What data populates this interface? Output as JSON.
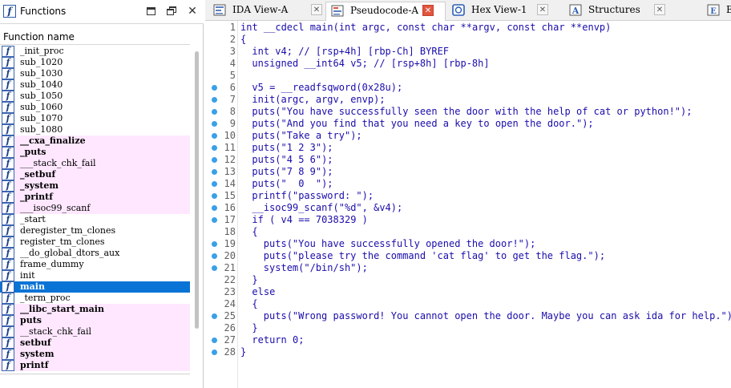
{
  "functions_panel": {
    "title": "Functions",
    "column_header": "Function name",
    "items": [
      {
        "name": "_init_proc",
        "lib": false,
        "bold": false
      },
      {
        "name": "sub_1020",
        "lib": false,
        "bold": false
      },
      {
        "name": "sub_1030",
        "lib": false,
        "bold": false
      },
      {
        "name": "sub_1040",
        "lib": false,
        "bold": false
      },
      {
        "name": "sub_1050",
        "lib": false,
        "bold": false
      },
      {
        "name": "sub_1060",
        "lib": false,
        "bold": false
      },
      {
        "name": "sub_1070",
        "lib": false,
        "bold": false
      },
      {
        "name": "sub_1080",
        "lib": false,
        "bold": false
      },
      {
        "name": "__cxa_finalize",
        "lib": true,
        "bold": true
      },
      {
        "name": "_puts",
        "lib": true,
        "bold": true
      },
      {
        "name": "___stack_chk_fail",
        "lib": true,
        "bold": false
      },
      {
        "name": "_setbuf",
        "lib": true,
        "bold": true
      },
      {
        "name": "_system",
        "lib": true,
        "bold": true
      },
      {
        "name": "_printf",
        "lib": true,
        "bold": true
      },
      {
        "name": "___isoc99_scanf",
        "lib": true,
        "bold": false
      },
      {
        "name": "_start",
        "lib": false,
        "bold": false
      },
      {
        "name": "deregister_tm_clones",
        "lib": false,
        "bold": false
      },
      {
        "name": "register_tm_clones",
        "lib": false,
        "bold": false
      },
      {
        "name": "__do_global_dtors_aux",
        "lib": false,
        "bold": false
      },
      {
        "name": "frame_dummy",
        "lib": false,
        "bold": false
      },
      {
        "name": "init",
        "lib": false,
        "bold": false
      },
      {
        "name": "main",
        "lib": false,
        "bold": true,
        "selected": true
      },
      {
        "name": "_term_proc",
        "lib": false,
        "bold": false
      },
      {
        "name": "__libc_start_main",
        "lib": true,
        "bold": true
      },
      {
        "name": "puts",
        "lib": true,
        "bold": true
      },
      {
        "name": "__stack_chk_fail",
        "lib": true,
        "bold": false
      },
      {
        "name": "setbuf",
        "lib": true,
        "bold": true
      },
      {
        "name": "system",
        "lib": true,
        "bold": true
      },
      {
        "name": "printf",
        "lib": true,
        "bold": true
      }
    ]
  },
  "tabs": [
    {
      "label": "IDA View-A",
      "icon": "ida-view-icon",
      "active": false
    },
    {
      "label": "Pseudocode-A",
      "icon": "pseudocode-icon",
      "active": true
    },
    {
      "label": "Hex View-1",
      "icon": "hex-view-icon",
      "active": false
    },
    {
      "label": "Structures",
      "icon": "structures-icon",
      "active": false
    },
    {
      "label": "En",
      "icon": "enums-icon",
      "active": false
    }
  ],
  "code": {
    "lines": [
      {
        "num": "1",
        "dot": false,
        "indent": 0,
        "text": "int __cdecl main(int argc, const char **argv, const char **envp)"
      },
      {
        "num": "2",
        "dot": false,
        "indent": 0,
        "text": "{"
      },
      {
        "num": "3",
        "dot": false,
        "indent": 2,
        "text": "int v4; // [rsp+4h] [rbp-Ch] BYREF",
        "style": "decl"
      },
      {
        "num": "4",
        "dot": false,
        "indent": 2,
        "text": "unsigned __int64 v5; // [rsp+8h] [rbp-8h]",
        "style": "decl"
      },
      {
        "num": "5",
        "dot": false,
        "indent": 0,
        "text": ""
      },
      {
        "num": "6",
        "dot": true,
        "indent": 2,
        "text": "v5 = __readfsqword(0x28u);"
      },
      {
        "num": "7",
        "dot": true,
        "indent": 2,
        "text": "init(argc, argv, envp);"
      },
      {
        "num": "8",
        "dot": true,
        "indent": 2,
        "text": "puts(\"You have successfully seen the door with the help of cat or python!\");"
      },
      {
        "num": "9",
        "dot": true,
        "indent": 2,
        "text": "puts(\"And you find that you need a key to open the door.\");"
      },
      {
        "num": "10",
        "dot": true,
        "indent": 2,
        "text": "puts(\"Take a try\");"
      },
      {
        "num": "11",
        "dot": true,
        "indent": 2,
        "text": "puts(\"1 2 3\");"
      },
      {
        "num": "12",
        "dot": true,
        "indent": 2,
        "text": "puts(\"4 5 6\");"
      },
      {
        "num": "13",
        "dot": true,
        "indent": 2,
        "text": "puts(\"7 8 9\");"
      },
      {
        "num": "14",
        "dot": true,
        "indent": 2,
        "text": "puts(\"  0  \");"
      },
      {
        "num": "15",
        "dot": true,
        "indent": 2,
        "text": "printf(\"password: \");"
      },
      {
        "num": "16",
        "dot": true,
        "indent": 2,
        "text": "__isoc99_scanf(\"%d\", &v4);"
      },
      {
        "num": "17",
        "dot": true,
        "indent": 2,
        "text": "if ( v4 == 7038329 )"
      },
      {
        "num": "18",
        "dot": false,
        "indent": 2,
        "text": "{"
      },
      {
        "num": "19",
        "dot": true,
        "indent": 4,
        "text": "puts(\"You have successfully opened the door!\");"
      },
      {
        "num": "20",
        "dot": true,
        "indent": 4,
        "text": "puts(\"please try the command 'cat flag' to get the flag.\");"
      },
      {
        "num": "21",
        "dot": true,
        "indent": 4,
        "text": "system(\"/bin/sh\");"
      },
      {
        "num": "22",
        "dot": false,
        "indent": 2,
        "text": "}"
      },
      {
        "num": "23",
        "dot": false,
        "indent": 2,
        "text": "else"
      },
      {
        "num": "24",
        "dot": false,
        "indent": 2,
        "text": "{"
      },
      {
        "num": "25",
        "dot": true,
        "indent": 4,
        "text": "puts(\"Wrong password! You cannot open the door. Maybe you can ask ida for help.\");"
      },
      {
        "num": "26",
        "dot": false,
        "indent": 2,
        "text": "}"
      },
      {
        "num": "27",
        "dot": true,
        "indent": 2,
        "text": "return 0;"
      },
      {
        "num": "28",
        "dot": true,
        "indent": 0,
        "text": "}"
      }
    ]
  },
  "colors": {
    "selection": "#0a74d6",
    "library_function_bg": "#ffe8ff",
    "line_dot": "#3aa0e8",
    "code_text": "#1326a8",
    "comment": "#8b93b8",
    "string": "#14804a"
  }
}
